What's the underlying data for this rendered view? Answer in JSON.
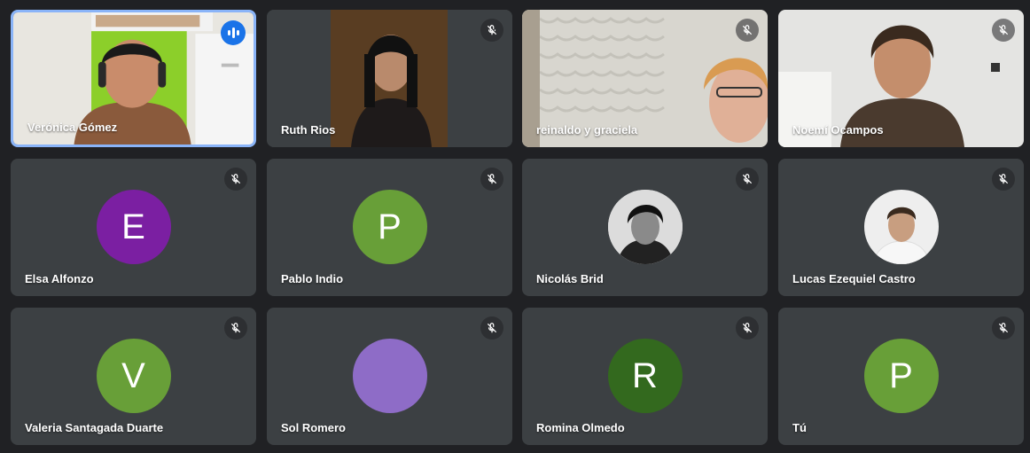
{
  "participants": [
    {
      "name": "Verónica Gómez",
      "type": "video",
      "speaking": true
    },
    {
      "name": "Ruth Rios",
      "type": "video",
      "muted": true
    },
    {
      "name": "reinaldo y graciela",
      "type": "video",
      "muted": true
    },
    {
      "name": "Noemí Ocampos",
      "type": "video",
      "muted": true
    },
    {
      "name": "Elsa Alfonzo",
      "type": "avatar",
      "initial": "E",
      "color": "#7b1fa2",
      "muted": true
    },
    {
      "name": "Pablo Indio",
      "type": "avatar",
      "initial": "P",
      "color": "#689f38",
      "muted": true
    },
    {
      "name": "Nicolás Brid",
      "type": "photo",
      "muted": true
    },
    {
      "name": "Lucas Ezequiel Castro",
      "type": "photo",
      "muted": true
    },
    {
      "name": "Valeria Santagada Duarte",
      "type": "avatar",
      "initial": "V",
      "color": "#689f38",
      "muted": true
    },
    {
      "name": "Sol Romero",
      "type": "avatar",
      "initial": "",
      "color": "#8e6cc7",
      "muted": true
    },
    {
      "name": "Romina Olmedo",
      "type": "avatar",
      "initial": "R",
      "color": "#33691e",
      "muted": true
    },
    {
      "name": "Tú",
      "type": "avatar",
      "initial": "P",
      "color": "#689f38",
      "muted": true
    }
  ],
  "icons": {
    "muted": "mic-off-icon",
    "speaking": "audio-level-icon"
  },
  "colors": {
    "background": "#202124",
    "tile": "#3c4043",
    "active_border": "#8ab4f8",
    "speaking_badge": "#1a73e8"
  }
}
